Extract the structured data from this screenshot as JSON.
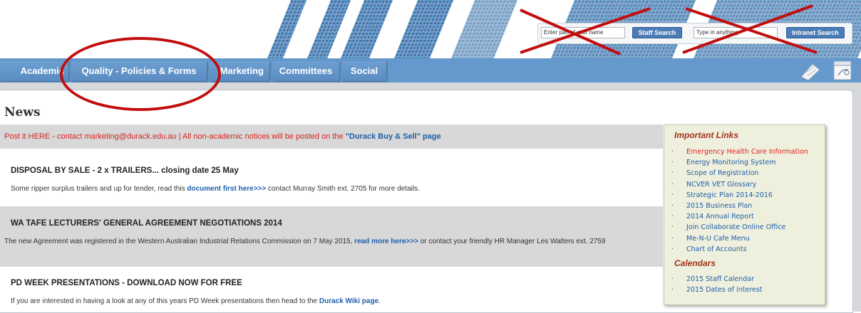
{
  "search": {
    "staff_placeholder": "Enter part of staff name",
    "staff_button": "Staff Search",
    "intranet_placeholder": "Type in anything",
    "intranet_button": "Intranet Search"
  },
  "nav": {
    "tabs": [
      {
        "label": "Academic"
      },
      {
        "label": "Quality - Policies & Forms"
      },
      {
        "label": "Marketing"
      },
      {
        "label": "Committees"
      },
      {
        "label": "Social"
      }
    ],
    "icons": [
      "notepad-icon",
      "calendar-icon"
    ]
  },
  "news": {
    "heading": "News",
    "notice": {
      "text": "Post it HERE - contact marketing@durack.edu.au  |   All non-academic notices will be posted on the",
      "link": "\"Durack Buy & Sell\" page"
    },
    "items": [
      {
        "title": "DISPOSAL BY SALE - 2 x TRAILERS... closing date 25 May",
        "body_before": "Some ripper surplus trailers and up for tender, read this ",
        "link": "document first here>>>",
        "body_after": " contact Murray Smith ext. 2705 for more details."
      },
      {
        "title": "WA TAFE LECTURERS' GENERAL AGREEMENT NEGOTIATIONS 2014",
        "body_before": "The new Agreement was registered in the Western Australian Industrial Relations Commission on 7 May 2015, ",
        "link": "read more here>>>",
        "body_after": " or contact your friendly HR Manager Les Walters ext. 2759"
      },
      {
        "title": "PD WEEK PRESENTATIONS - DOWNLOAD NOW FOR FREE",
        "body_before": "If you are interested in having a look at any of this years PD Week presentations then head to the ",
        "link": "Durack Wiki page",
        "body_after": "."
      }
    ]
  },
  "sidebar": {
    "important_heading": "Important Links",
    "important_links": [
      "Emergency Health Care Information",
      "Energy Monitoring System",
      "Scope of Registration",
      "NCVER VET Glossary",
      "Strategic Plan 2014-2016",
      "2015 Business Plan",
      "2014 Annual Report",
      "Join Collaborate Online Office",
      "Me-N-U Cafe Menu",
      "Chart of Accounts"
    ],
    "calendars_heading": "Calendars",
    "calendar_links": [
      "2015 Staff Calendar",
      "2015 Dates of interest"
    ]
  },
  "colors": {
    "nav_bg": "#6598cc",
    "link": "#1e5fa8",
    "alert": "#d9231e",
    "annotation": "#c10d0d"
  }
}
